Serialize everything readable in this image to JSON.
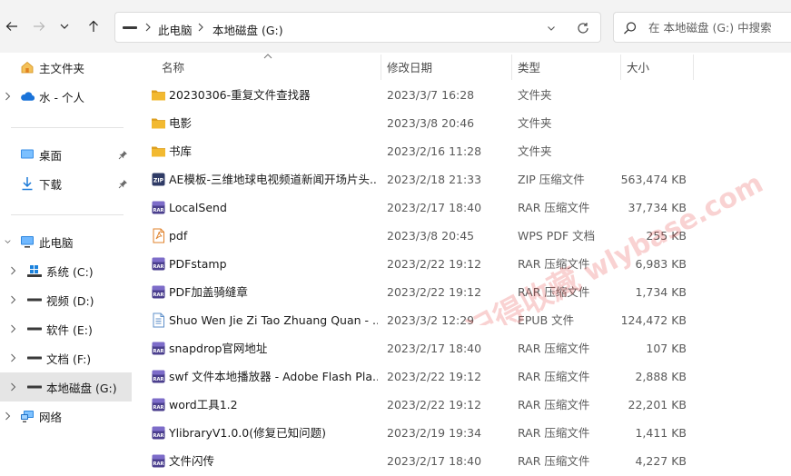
{
  "toolbar": {
    "address": {
      "crumbs": [
        "此电脑",
        "本地磁盘 (G:)"
      ]
    },
    "search": {
      "placeholder": "在 本地磁盘 (G:) 中搜索"
    }
  },
  "nav": {
    "items": [
      {
        "label": "主文件夹",
        "icon": "home-icon"
      },
      {
        "label": "水 - 个人",
        "icon": "onedrive-cloud-icon"
      },
      {
        "label": "桌面",
        "icon": "desktop-icon",
        "pinned": true
      },
      {
        "label": "下载",
        "icon": "download-icon",
        "pinned": true
      },
      {
        "label": "此电脑",
        "icon": "computer-icon"
      },
      {
        "label": "系统 (C:)",
        "icon": "windows-drive-icon"
      },
      {
        "label": "视频 (D:)",
        "icon": "drive-icon"
      },
      {
        "label": "软件 (E:)",
        "icon": "drive-icon"
      },
      {
        "label": "文档 (F:)",
        "icon": "drive-icon"
      },
      {
        "label": "本地磁盘 (G:)",
        "icon": "drive-icon",
        "selected": true
      },
      {
        "label": "网络",
        "icon": "network-icon"
      }
    ]
  },
  "columns": {
    "name": "名称",
    "date": "修改日期",
    "type": "类型",
    "size": "大小"
  },
  "files": [
    {
      "name": "20230306-重复文件查找器",
      "date": "2023/3/7 16:28",
      "type": "文件夹",
      "size": "",
      "icon": "folder"
    },
    {
      "name": "电影",
      "date": "2023/3/8 20:46",
      "type": "文件夹",
      "size": "",
      "icon": "folder"
    },
    {
      "name": "书库",
      "date": "2023/2/16 11:28",
      "type": "文件夹",
      "size": "",
      "icon": "folder"
    },
    {
      "name": "AE模板-三维地球电视频道新闻开场片头...",
      "date": "2023/2/18 21:33",
      "type": "ZIP 压缩文件",
      "size": "563,474 KB",
      "icon": "zip"
    },
    {
      "name": "LocalSend",
      "date": "2023/2/17 18:40",
      "type": "RAR 压缩文件",
      "size": "37,734 KB",
      "icon": "rar"
    },
    {
      "name": "pdf",
      "date": "2023/3/8 20:45",
      "type": "WPS PDF 文档",
      "size": "255 KB",
      "icon": "pdf"
    },
    {
      "name": "PDFstamp",
      "date": "2023/2/22 19:12",
      "type": "RAR 压缩文件",
      "size": "6,983 KB",
      "icon": "rar"
    },
    {
      "name": "PDF加盖骑缝章",
      "date": "2023/2/22 19:12",
      "type": "RAR 压缩文件",
      "size": "1,734 KB",
      "icon": "rar"
    },
    {
      "name": "Shuo Wen Jie Zi Tao Zhuang Quan - ...",
      "date": "2023/3/2 12:29",
      "type": "EPUB 文件",
      "size": "124,472 KB",
      "icon": "epub"
    },
    {
      "name": "snapdrop官网地址",
      "date": "2023/2/17 18:40",
      "type": "RAR 压缩文件",
      "size": "107 KB",
      "icon": "rar"
    },
    {
      "name": "swf 文件本地播放器 - Adobe Flash Pla...",
      "date": "2023/2/22 19:12",
      "type": "RAR 压缩文件",
      "size": "2,888 KB",
      "icon": "rar"
    },
    {
      "name": "word工具1.2",
      "date": "2023/2/22 19:12",
      "type": "RAR 压缩文件",
      "size": "22,201 KB",
      "icon": "rar"
    },
    {
      "name": "YlibraryV1.0.0(修复已知问题)",
      "date": "2023/2/19 19:34",
      "type": "RAR 压缩文件",
      "size": "1,411 KB",
      "icon": "rar"
    },
    {
      "name": "文件闪传",
      "date": "2023/2/17 18:40",
      "type": "RAR 压缩文件",
      "size": "4,227 KB",
      "icon": "rar"
    }
  ],
  "watermark": {
    "line1": "记得收藏",
    "line2": "wlybase.com"
  },
  "colors": {
    "folder": "#f2b930",
    "folder_dark": "#dea020",
    "rar": "#4b3f8e",
    "watermark": "#e53935"
  }
}
